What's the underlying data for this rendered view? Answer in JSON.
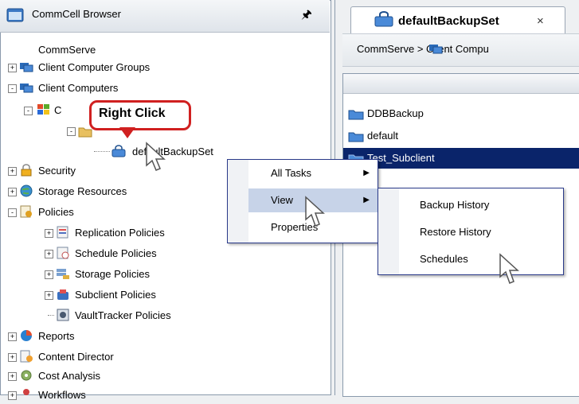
{
  "left_panel": {
    "title": "CommCell Browser",
    "pin_glyph": "ᵖ",
    "tree": [
      {
        "label": "CommServe",
        "icon": "none",
        "exp": ""
      },
      {
        "label": "Client Computer Groups",
        "icon": "computer-group-icon",
        "exp": "+"
      },
      {
        "label": "Client Computers",
        "icon": "computers-icon",
        "exp": "-"
      },
      {
        "label": "C",
        "icon": "windows-icon",
        "exp": "-"
      },
      {
        "label": "",
        "icon": "folder-icon",
        "exp": "-"
      },
      {
        "label": "defaultBackupSet",
        "icon": "backupset-icon",
        "exp": ""
      },
      {
        "label": "Security",
        "icon": "lock-icon",
        "exp": "+"
      },
      {
        "label": "Storage Resources",
        "icon": "globe-icon",
        "exp": "+"
      },
      {
        "label": "Policies",
        "icon": "policies-icon",
        "exp": "-"
      },
      {
        "label": "Replication Policies",
        "icon": "replication-icon",
        "exp": "+"
      },
      {
        "label": "Schedule Policies",
        "icon": "schedule-icon",
        "exp": "+"
      },
      {
        "label": "Storage Policies",
        "icon": "storage-icon",
        "exp": "+"
      },
      {
        "label": "Subclient Policies",
        "icon": "subclient-icon",
        "exp": "+"
      },
      {
        "label": "VaultTracker Policies",
        "icon": "vault-icon",
        "exp": ""
      },
      {
        "label": "Reports",
        "icon": "reports-icon",
        "exp": "+"
      },
      {
        "label": "Content Director",
        "icon": "content-icon",
        "exp": "+"
      },
      {
        "label": "Cost Analysis",
        "icon": "cost-icon",
        "exp": "+"
      },
      {
        "label": "Workflows",
        "icon": "workflow-icon",
        "exp": "+"
      }
    ]
  },
  "callout": {
    "text": "Right Click"
  },
  "tab": {
    "title": "defaultBackupSet",
    "close": "×"
  },
  "breadcrumb": {
    "text": "CommServe  >      Client Compu"
  },
  "list": {
    "items": [
      {
        "label": "DDBBackup",
        "selected": false
      },
      {
        "label": "default",
        "selected": false
      },
      {
        "label": "Test_Subclient",
        "selected": true
      }
    ]
  },
  "context_menu": {
    "items": [
      {
        "label": "All Tasks",
        "arrow": "▶"
      },
      {
        "label": "View",
        "arrow": "▶"
      },
      {
        "label": "Properties",
        "arrow": ""
      }
    ]
  },
  "submenu": {
    "items": [
      {
        "label": "Backup History"
      },
      {
        "label": "Restore History"
      },
      {
        "label": "Schedules"
      }
    ]
  },
  "colors": {
    "selection": "#0a246a",
    "callout_border": "#d02020",
    "menu_border": "#2a3a8a"
  }
}
